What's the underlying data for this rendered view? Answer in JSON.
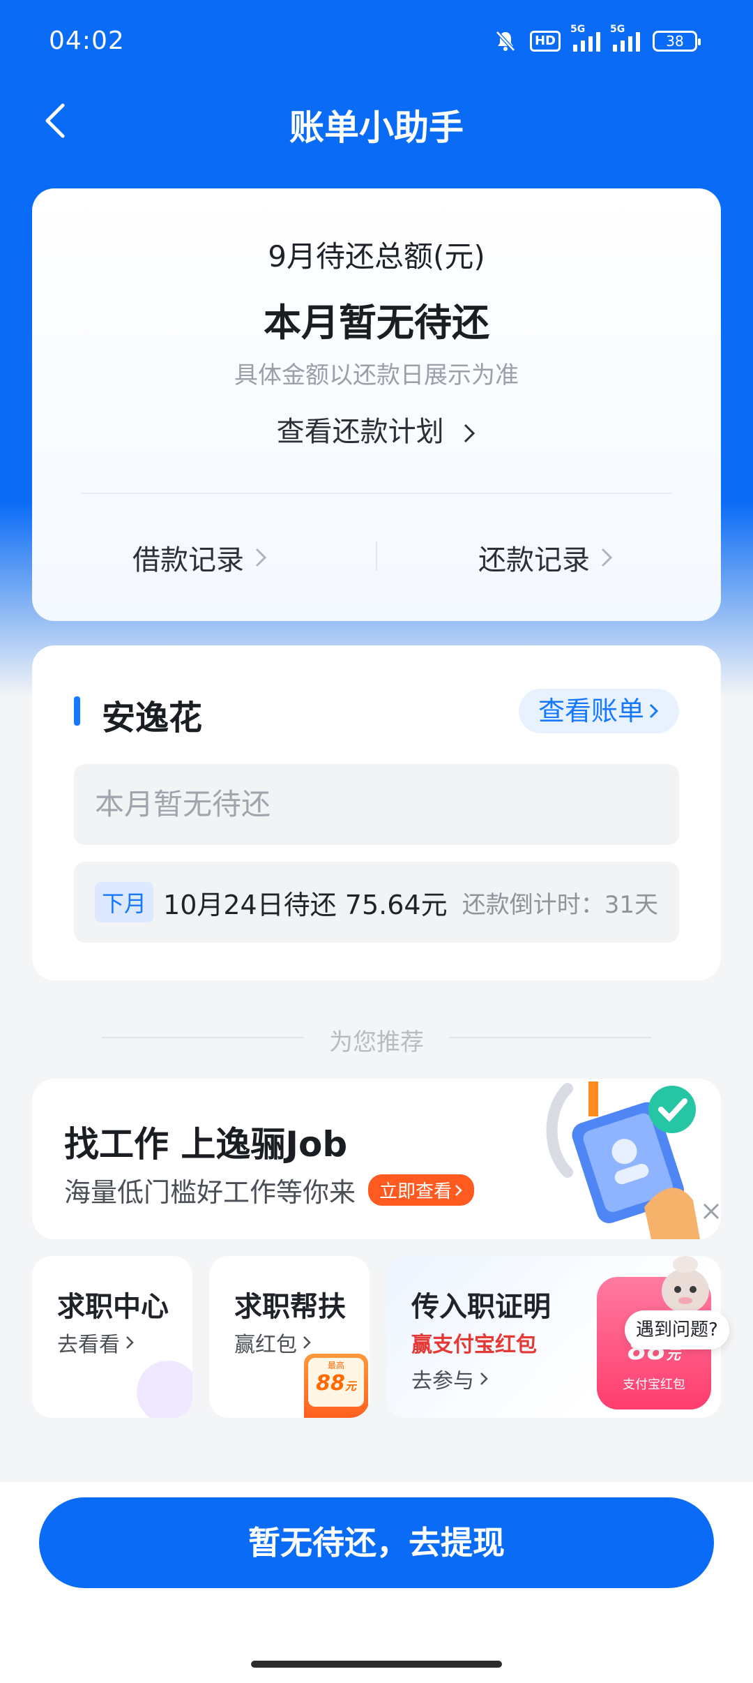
{
  "status_bar": {
    "time": "04:02",
    "hd": "HD",
    "net1": "5G",
    "net2": "5G",
    "battery": "38"
  },
  "header": {
    "title": "账单小助手"
  },
  "summary": {
    "label": "9月待还总额(元)",
    "main": "本月暂无待还",
    "note": "具体金额以还款日展示为准",
    "plan_link": "查看还款计划",
    "borrow_records": "借款记录",
    "repay_records": "还款记录"
  },
  "product": {
    "name": "安逸花",
    "view_bill": "查看账单",
    "empty": "本月暂无待还",
    "next_tag": "下月",
    "next_text": "10月24日待还 75.64元",
    "countdown": "还款倒计时：31天"
  },
  "recommend": {
    "label": "为您推荐"
  },
  "job_banner": {
    "title": "找工作 上逸骊Job",
    "subtitle": "海量低门槛好工作等你来",
    "button": "立即查看"
  },
  "mini_cards": [
    {
      "title": "求职中心",
      "sub": "去看看"
    },
    {
      "title": "求职帮扶",
      "sub": "赢红包",
      "badge_amount": "88",
      "badge_unit": "元",
      "badge_top": "最高"
    },
    {
      "title": "传入职证明",
      "sub": "赢支付宝红包",
      "go": "去参与",
      "box_amount": "88",
      "box_unit": "元",
      "box_label": "支付宝红包"
    }
  ],
  "help": {
    "label": "遇到问题?"
  },
  "cta": {
    "label": "暂无待还，去提现"
  },
  "colors": {
    "primary": "#0a6cf6",
    "accent_orange": "#ff5a1f",
    "red_text": "#e53935"
  }
}
